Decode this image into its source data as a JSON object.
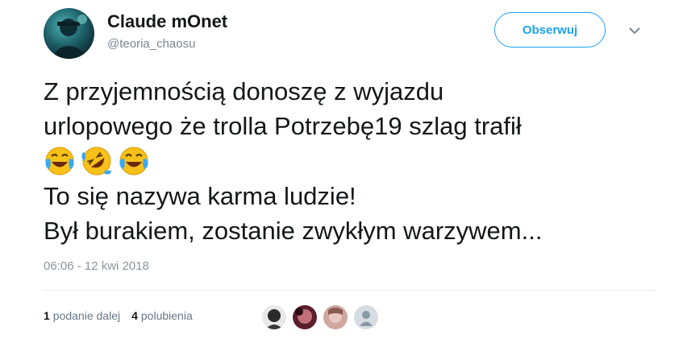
{
  "author": {
    "display_name": "Claude mOnet",
    "handle": "@teoria_chaosu",
    "avatar_icon": "profile-avatar"
  },
  "follow_button": {
    "label": "Obserwuj",
    "color": "#1da1f2"
  },
  "menu_icon": "chevron-down-icon",
  "tweet": {
    "line1": "Z przyjemnością donoszę z wyjazdu",
    "line2": "urlopowego że trolla Potrzebę19 szlag trafił",
    "emojis": [
      "face-with-tears-of-joy",
      "rolling-on-floor-laughing",
      "face-with-tears-of-joy"
    ],
    "line3": "To się nazywa karma ludzie!",
    "line4": "Był burakiem, zostanie zwykłym warzywem..."
  },
  "timestamp": "06:06 - 12 kwi 2018",
  "stats": {
    "retweets_count": "1",
    "retweets_label": "podanie dalej",
    "likes_count": "4",
    "likes_label": "polubienia"
  }
}
